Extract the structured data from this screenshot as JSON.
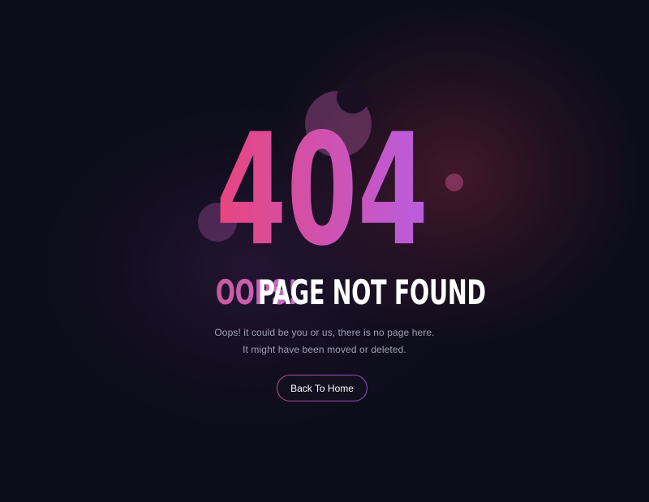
{
  "error": {
    "code": "404",
    "heading_accent": "OOPS!",
    "heading_main": "PAGE NOT FOUND",
    "description_line1": "Oops! it could be you or us, there is no page here.",
    "description_line2": "It might have been moved or deleted."
  },
  "actions": {
    "home_label": "Back To Home"
  },
  "colors": {
    "background": "#0d0d1a",
    "gradient_start": "#e8457e",
    "gradient_end": "#b85ee0",
    "text_muted": "#a0a0b4"
  }
}
